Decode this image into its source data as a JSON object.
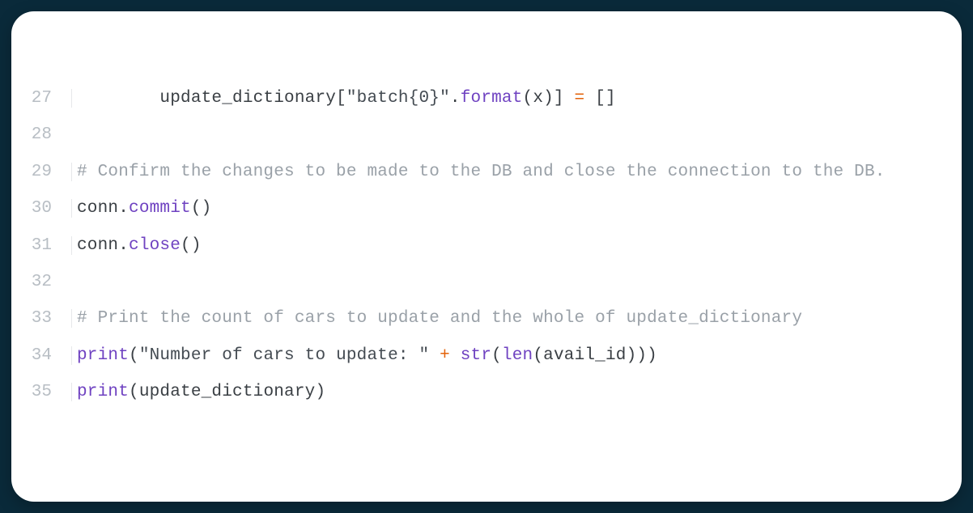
{
  "colors": {
    "background": "#0a2a3a",
    "card": "#ffffff",
    "gutter": "#b8bec4",
    "text": "#3a3f44",
    "comment": "#9aa1a8",
    "func": "#6f42c1",
    "op": "#e36209"
  },
  "lines": [
    {
      "num": "27",
      "tokens": [
        {
          "cls": "c-ident",
          "t": "        update_dictionary"
        },
        {
          "cls": "c-punc",
          "t": "["
        },
        {
          "cls": "c-string",
          "t": "\"batch{0}\""
        },
        {
          "cls": "c-punc",
          "t": "."
        },
        {
          "cls": "c-func",
          "t": "format"
        },
        {
          "cls": "c-punc",
          "t": "(x)] "
        },
        {
          "cls": "c-op",
          "t": "="
        },
        {
          "cls": "c-punc",
          "t": " []"
        }
      ]
    },
    {
      "num": "28",
      "tokens": [
        {
          "cls": "c-ident",
          "t": ""
        }
      ]
    },
    {
      "num": "29",
      "tokens": [
        {
          "cls": "c-comment",
          "t": "# Confirm the changes to be made to the DB and close the connection to the DB."
        }
      ]
    },
    {
      "num": "30",
      "tokens": [
        {
          "cls": "c-ident",
          "t": "conn"
        },
        {
          "cls": "c-punc",
          "t": "."
        },
        {
          "cls": "c-func",
          "t": "commit"
        },
        {
          "cls": "c-punc",
          "t": "()"
        }
      ]
    },
    {
      "num": "31",
      "tokens": [
        {
          "cls": "c-ident",
          "t": "conn"
        },
        {
          "cls": "c-punc",
          "t": "."
        },
        {
          "cls": "c-func",
          "t": "close"
        },
        {
          "cls": "c-punc",
          "t": "()"
        }
      ]
    },
    {
      "num": "32",
      "tokens": [
        {
          "cls": "c-ident",
          "t": ""
        }
      ]
    },
    {
      "num": "33",
      "tokens": [
        {
          "cls": "c-comment",
          "t": "# Print the count of cars to update and the whole of update_dictionary"
        }
      ]
    },
    {
      "num": "34",
      "tokens": [
        {
          "cls": "c-builtin",
          "t": "print"
        },
        {
          "cls": "c-punc",
          "t": "("
        },
        {
          "cls": "c-string",
          "t": "\"Number of cars to update: \""
        },
        {
          "cls": "c-punc",
          "t": " "
        },
        {
          "cls": "c-op",
          "t": "+"
        },
        {
          "cls": "c-punc",
          "t": " "
        },
        {
          "cls": "c-builtin",
          "t": "str"
        },
        {
          "cls": "c-punc",
          "t": "("
        },
        {
          "cls": "c-builtin",
          "t": "len"
        },
        {
          "cls": "c-punc",
          "t": "(avail_id)))"
        }
      ]
    },
    {
      "num": "35",
      "tokens": [
        {
          "cls": "c-builtin",
          "t": "print"
        },
        {
          "cls": "c-punc",
          "t": "(update_dictionary)"
        }
      ]
    }
  ]
}
